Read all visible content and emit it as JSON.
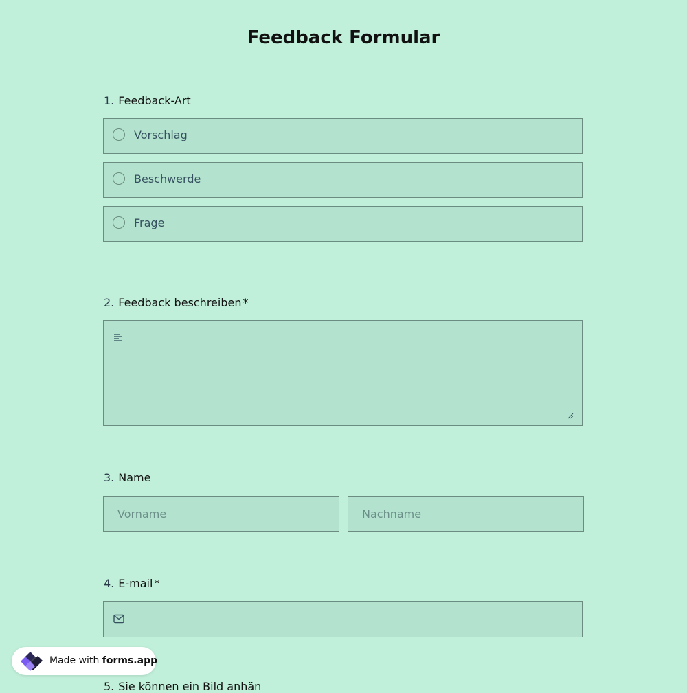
{
  "form": {
    "title": "Feedback Formular"
  },
  "questions": {
    "q1": {
      "number": "1.",
      "label": "Feedback-Art",
      "options": [
        "Vorschlag",
        "Beschwerde",
        "Frage"
      ]
    },
    "q2": {
      "number": "2.",
      "label": "Feedback beschreiben",
      "required_mark": "*"
    },
    "q3": {
      "number": "3.",
      "label": "Name",
      "first_placeholder": "Vorname",
      "last_placeholder": "Nachname"
    },
    "q4": {
      "number": "4.",
      "label": "E-mail",
      "required_mark": "*"
    },
    "q5": {
      "number": "5.",
      "label_partial": "Sie können ein Bild anhän"
    }
  },
  "badge": {
    "prefix": "Made with ",
    "brand": "forms.app"
  },
  "icons": {
    "text": "text-lines-icon",
    "mail": "mail-icon",
    "resize": "resize-handle-icon",
    "logo": "forms-app-logo-icon"
  },
  "colors": {
    "background": "#c1f0da",
    "field": "#b3e3cf",
    "border": "#6b8c80",
    "logo_purple": "#7b5cf0",
    "logo_dark": "#1f1f3a"
  }
}
